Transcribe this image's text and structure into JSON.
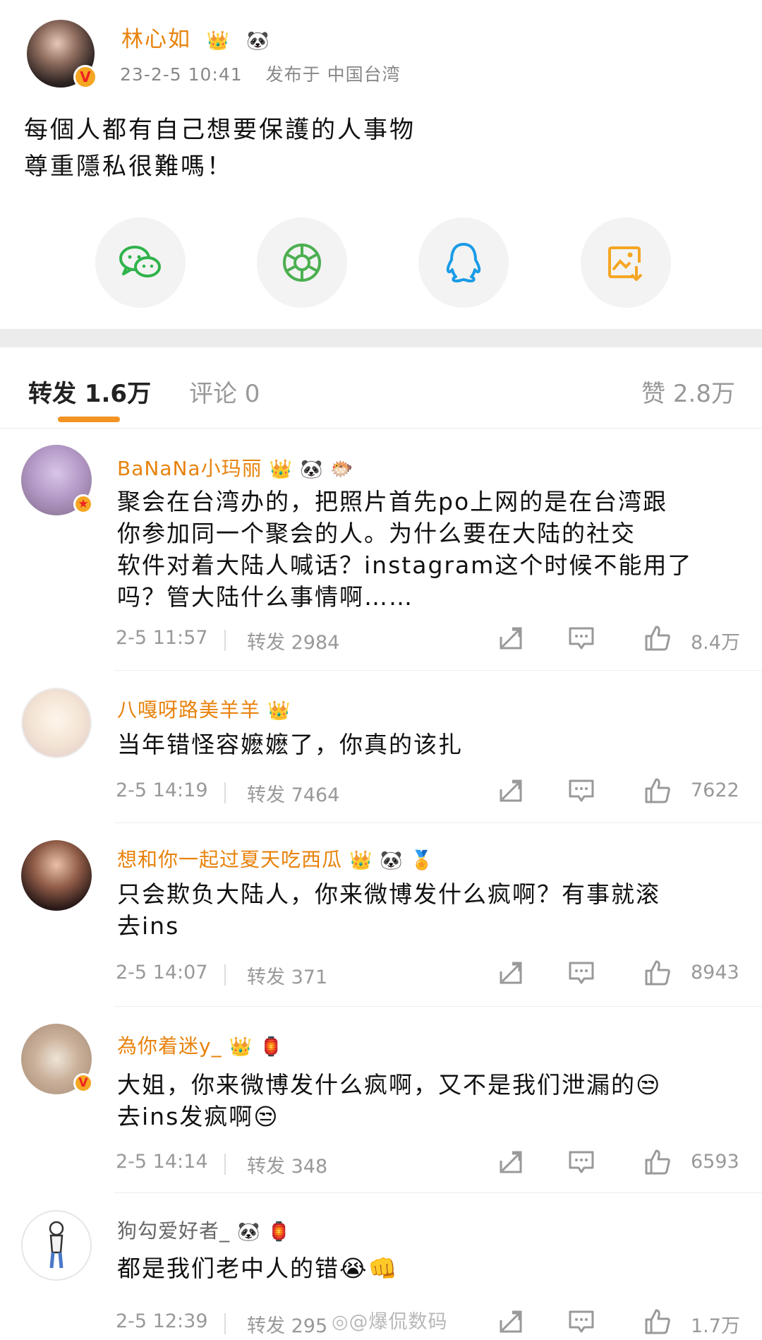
{
  "post": {
    "author": "林心如",
    "author_badges": [
      "👑",
      "🐼"
    ],
    "date": "23-2-5 10:41",
    "location": "发布于 中国台湾",
    "text_line1": "每個人都有自己想要保護的人事物",
    "text_line2": "尊重隱私很難嗎！",
    "share_targets": [
      {
        "name": "wechat-icon",
        "color": "#2fb34a"
      },
      {
        "name": "moments-icon",
        "color": "#4caf50"
      },
      {
        "name": "qq-icon",
        "color": "#1a9be6"
      },
      {
        "name": "save-image-icon",
        "color": "#f5a623"
      }
    ]
  },
  "tabs": {
    "repost": "转发 1.6万",
    "comment": "评论 0",
    "like": "赞 2.8万",
    "accent": "#f39323"
  },
  "comments": [
    {
      "name": "BaNaNa小玛丽",
      "badges": [
        "👑",
        "🐼",
        "🐡"
      ],
      "lines": [
        "聚会在台湾办的，把照片首先po上网的是在台湾跟",
        "你参加同一个聚会的人。为什么要在大陆的社交",
        "软件对着大陆人喊话？instagram这个时候不能用了",
        "吗？管大陆什么事情啊……"
      ],
      "time": "2-5 11:57",
      "repost": "转发 2984",
      "likes": "8.4万"
    },
    {
      "name": "八嘎呀路美羊羊",
      "badges": [
        "👑"
      ],
      "lines": [
        "当年错怪容嬷嬷了，你真的该扎"
      ],
      "time": "2-5 14:19",
      "repost": "转发 7464",
      "likes": "7622"
    },
    {
      "name": "想和你一起过夏天吃西瓜",
      "badges": [
        "👑",
        "🐼",
        "🏅"
      ],
      "lines": [
        "只会欺负大陆人，你来微博发什么疯啊？有事就滚",
        "去ins"
      ],
      "time": "2-5 14:07",
      "repost": "转发 371",
      "likes": "8943"
    },
    {
      "name": "為你着迷y_",
      "badges": [
        "👑",
        "🏮"
      ],
      "lines": [
        "大姐，你来微博发什么疯啊，又不是我们泄漏的😒",
        "去ins发疯啊😒"
      ],
      "time": "2-5 14:14",
      "repost": "转发 348",
      "likes": "6593"
    },
    {
      "name": "狗勾爱好者_",
      "badges": [
        "🐼",
        "🏮"
      ],
      "lines": [
        "都是我们老中人的错😭👊"
      ],
      "time": "2-5 12:39",
      "repost": "转发 295",
      "likes": "1.7万"
    }
  ],
  "watermark": "◎@爆侃数码"
}
